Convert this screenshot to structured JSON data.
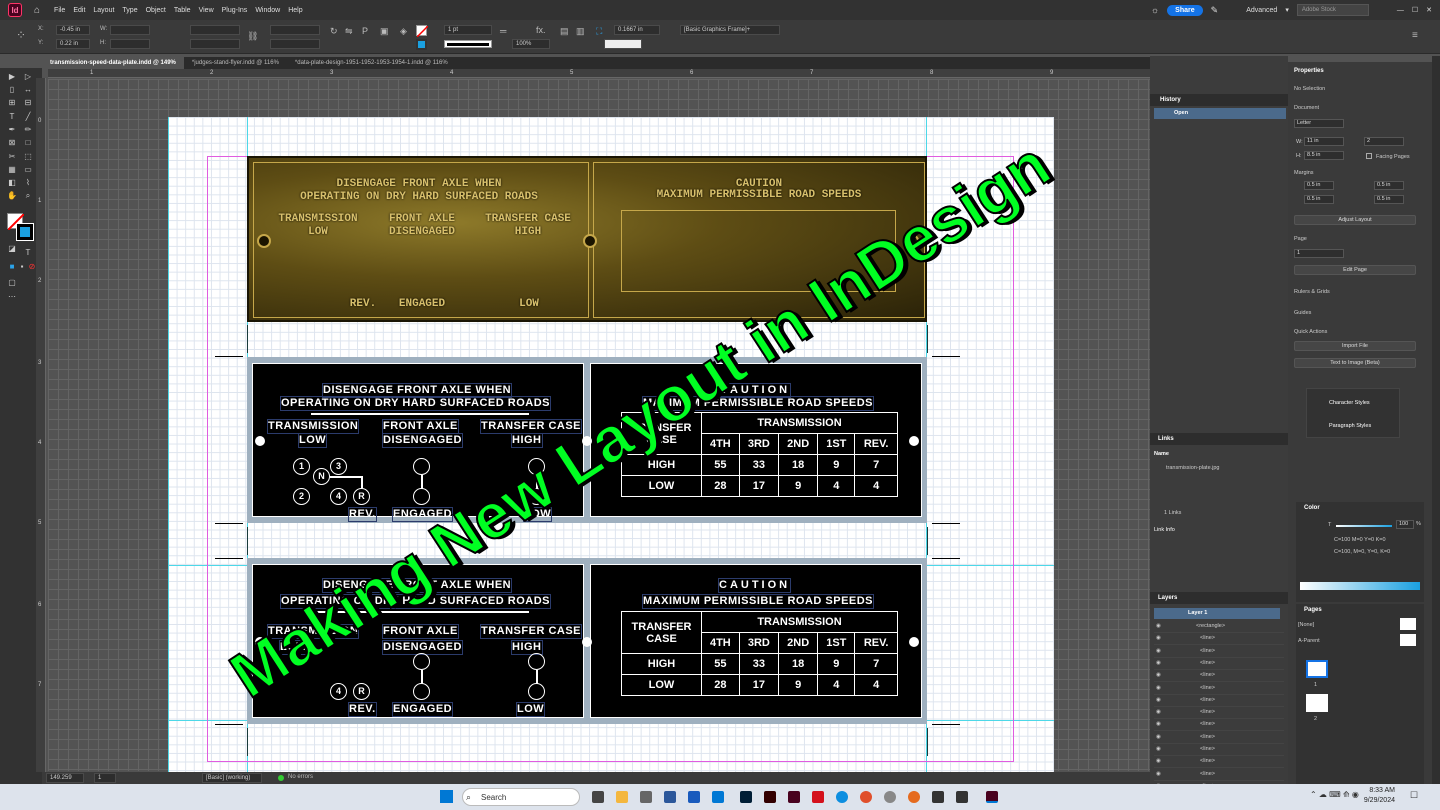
{
  "app": {
    "icon_letters": "Id",
    "menu": [
      "File",
      "Edit",
      "Layout",
      "Type",
      "Object",
      "Table",
      "View",
      "Plug-Ins",
      "Window",
      "Help"
    ],
    "share_label": "Share",
    "workspace": "Advanced",
    "stock_placeholder": "Adobe Stock"
  },
  "control": {
    "x_label": "X:",
    "x_value": "-0.45 in",
    "y_label": "Y:",
    "y_value": "0.22 in",
    "w_label": "W:",
    "h_label": "H:",
    "stroke_weight": "1 pt",
    "zoom": "100%",
    "ref_value": "0.1667 in",
    "frame_style": "[Basic Graphics Frame]+"
  },
  "tabs": [
    "transmission-speed-data-plate.indd @ 149%",
    "*judges-stand-flyer.indd @ 116%",
    "*data-plate-design-1951-1952-1953-1954-1.indd @ 116%"
  ],
  "ruler_h": [
    "1",
    "2",
    "3",
    "4",
    "5",
    "6",
    "7",
    "8",
    "9",
    "10",
    "11"
  ],
  "ruler_v": [
    "0",
    "1",
    "2",
    "3",
    "4",
    "5",
    "6",
    "7"
  ],
  "plate": {
    "left_title_1": "DISENGAGE FRONT AXLE WHEN",
    "left_title_2": "OPERATING ON DRY HARD SURFACED ROADS",
    "col1_a": "TRANSMISSION",
    "col1_b": "LOW",
    "col2_a": "FRONT AXLE",
    "col2_b": "DISENGAGED",
    "col3_a": "TRANSFER CASE",
    "col3_b": "HIGH",
    "gear_1": "1",
    "gear_2": "2",
    "gear_3": "3",
    "gear_4": "4",
    "gear_n": "N",
    "gear_r": "R",
    "rev": "REV.",
    "engaged": "ENGAGED",
    "low": "LOW",
    "right_title_1": "CAUTION",
    "right_title_2": "MAXIMUM PERMISSIBLE ROAD SPEEDS",
    "tc_a": "TRANSFER",
    "tc_b": "CASE",
    "trans": "TRANSMISSION",
    "gears": [
      "4TH",
      "3RD",
      "2ND",
      "1ST",
      "REV."
    ],
    "high": "HIGH",
    "high_row": [
      "55",
      "33",
      "18",
      "9",
      "7"
    ],
    "low_row_label": "LOW",
    "low_row": [
      "28",
      "17",
      "9",
      "4",
      "4"
    ]
  },
  "overlay_text": "Making New Layout in InDesign",
  "status": {
    "zoom": "149.259",
    "page": "1",
    "style": "[Basic] (working)",
    "errors": "No errors"
  },
  "history": {
    "title": "History",
    "item": "Open"
  },
  "links": {
    "title": "Links",
    "name_col": "Name",
    "file": "transmission-plate.jpg",
    "count": "1 Links",
    "link_info": "Link Info"
  },
  "layers": {
    "title": "Layers",
    "layer": "Layer 1",
    "items": [
      "<rectangle>",
      "<line>",
      "<line>",
      "<line>",
      "<line>",
      "<line>",
      "<line>",
      "<line>",
      "<line>",
      "<line>",
      "<line>",
      "<line>",
      "<line>",
      "<line>"
    ]
  },
  "properties": {
    "title": "Properties",
    "selection": "No Selection",
    "document": "Document",
    "preset": "Letter",
    "w_label": "W:",
    "w_value": "11 in",
    "h_label": "H:",
    "h_value": "8.5 in",
    "pages_value": "2",
    "facing": "Facing Pages",
    "margins": "Margins",
    "m1": "0.5 in",
    "m2": "0.5 in",
    "m3": "0.5 in",
    "m4": "0.5 in",
    "adjust": "Adjust Layout",
    "page": "Page",
    "page_value": "1",
    "edit_page": "Edit Page",
    "rulers": "Rulers & Grids",
    "guides": "Guides",
    "quick": "Quick Actions",
    "import": "Import File",
    "t2i": "Text to Image (Beta)"
  },
  "styles": {
    "char": "Character Styles",
    "para": "Paragraph Styles"
  },
  "color": {
    "title": "Color",
    "tint": "100",
    "pct": "%",
    "cmyk1": "C=100 M=0 Y=0 K=0",
    "cmyk2": "C=100, M=0, Y=0, K=0",
    "t": "T"
  },
  "pages": {
    "title": "Pages",
    "none": "[None]",
    "parent": "A-Parent",
    "p1": "1",
    "p2": "2"
  },
  "taskbar": {
    "search": "Search",
    "time": "8:33 AM",
    "date": "9/29/2024"
  }
}
